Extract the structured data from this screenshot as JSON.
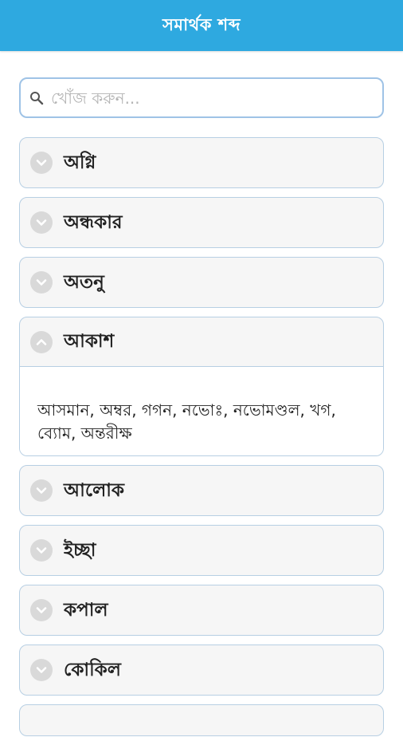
{
  "header": {
    "title": "সমার্থক শব্দ"
  },
  "search": {
    "placeholder": "খোঁজ করুন..."
  },
  "items": [
    {
      "label": "অগ্নি",
      "expanded": false
    },
    {
      "label": "অন্ধকার",
      "expanded": false
    },
    {
      "label": "অতনু",
      "expanded": false
    },
    {
      "label": "আকাশ",
      "expanded": true,
      "content": "আসমান, অম্বর, গগন, নভোঃ, নভোমণ্ডল, খগ, ব্যোম, অন্তরীক্ষ"
    },
    {
      "label": "আলোক",
      "expanded": false
    },
    {
      "label": "ইচ্ছা",
      "expanded": false
    },
    {
      "label": "কপাল",
      "expanded": false
    },
    {
      "label": "কোকিল",
      "expanded": false
    }
  ],
  "colors": {
    "header": "#2ea9e0",
    "border": "#b7cfe3",
    "icon_bg": "#d9d9d9"
  },
  "icons": {
    "search": "search-icon",
    "collapsed": "chevron-down-icon",
    "expanded": "chevron-up-icon"
  }
}
